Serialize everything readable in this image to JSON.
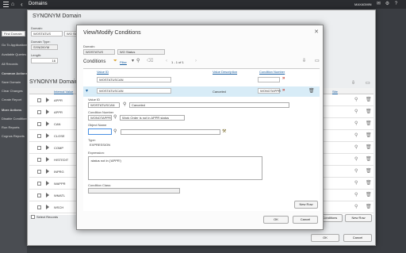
{
  "app": {
    "title": "Domains",
    "user": "MAXADMIN"
  },
  "sidebar": {
    "search_placeholder": "Find Domain",
    "items": [
      {
        "label": "Go To Applications"
      },
      {
        "label": "Available Queries"
      },
      {
        "label": "All Records"
      },
      {
        "label": "Common Actions"
      },
      {
        "label": "Save Domain"
      },
      {
        "label": "Clear Changes"
      },
      {
        "label": "Create Report"
      },
      {
        "label": "More Actions"
      },
      {
        "label": "Disable Conditions"
      },
      {
        "label": "Run Reports"
      },
      {
        "label": "Cognos Reports"
      }
    ]
  },
  "bg_dialog": {
    "title": "SYNONYM Domain",
    "domain_label": "Domain:",
    "domain_value": "WOSTATUS",
    "domain_desc": "WO Status",
    "type_label": "Domain Type:",
    "type_value": "SYNONYM",
    "length_label": "Length:",
    "length_value": "16",
    "section_title": "SYNONYM Domain",
    "col_internal": "Internal Value",
    "col_org": "Org",
    "col_site": "Site",
    "rows": [
      {
        "code": "APPR"
      },
      {
        "code": "APPR"
      },
      {
        "code": "CAN"
      },
      {
        "code": "CLOSE"
      },
      {
        "code": "COMP"
      },
      {
        "code": "HISTEDIT"
      },
      {
        "code": "INPRG"
      },
      {
        "code": "WAPPR"
      },
      {
        "code": "WMATL"
      },
      {
        "code": "WSCH"
      }
    ],
    "select_records": "Select Records",
    "view_conditions": "View Conditions",
    "new_row": "New Row",
    "ok": "OK",
    "cancel": "Cancel"
  },
  "dialog": {
    "title": "View/Modify Conditions",
    "domain_label": "Domain:",
    "domain_value": "WOSTATUS",
    "domain_desc": "WO Status",
    "conditions_title": "Conditions",
    "filter_label": "Filter",
    "pager": "1 - 1 of 1",
    "col_value_id": "Value ID",
    "col_value_desc": "Value Description",
    "col_condition": "Condition Number",
    "rows": [
      {
        "value_id": "WOSTATUSCAN",
        "desc": "",
        "condition": ""
      },
      {
        "value_id": "WOSTATUSCAN",
        "desc": "Canceled",
        "condition": "WONOTAPPR"
      }
    ],
    "detail": {
      "value_id_label": "Value ID",
      "value_id": "WOSTATUSCAN",
      "value_desc": "Canceled",
      "condition_label": "Condition Number",
      "condition_value": "WONOTAPPR",
      "condition_desc": "Work Order is not in APPR status",
      "object_label": "Object Name",
      "object_value": "",
      "type_label": "Type:",
      "type_value": "EXPRESSION",
      "expression_label": "Expression:",
      "expression_value": ":status not in ('APPR')",
      "class_label": "Condition Class:",
      "class_value": ""
    },
    "new_row": "New Row",
    "ok": "OK",
    "cancel": "Cancel"
  }
}
